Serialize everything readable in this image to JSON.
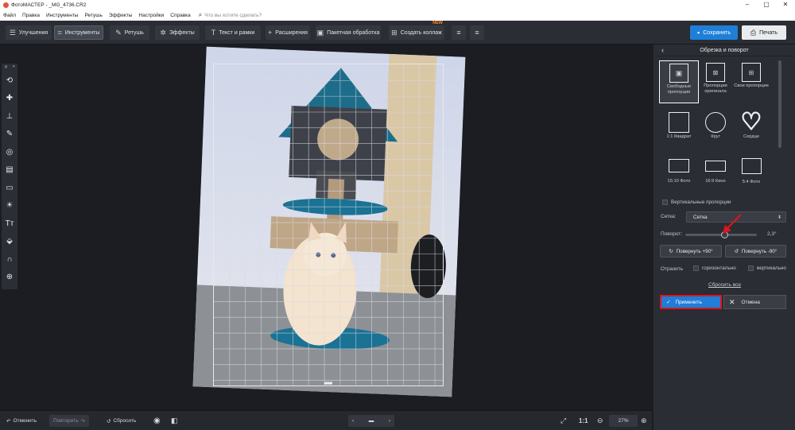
{
  "titlebar": {
    "title": "ФотоМАСТЕР - _MG_4736.CR2"
  },
  "menu": {
    "items": [
      "Файл",
      "Правка",
      "Инструменты",
      "Ретушь",
      "Эффекты",
      "Настройки",
      "Справка"
    ],
    "search_placeholder": "Что вы хотите сделать?"
  },
  "toolbar": {
    "tabs": [
      "Улучшения",
      "Инструменты",
      "Ретушь",
      "Эффекты",
      "Текст и рамки",
      "Расширения"
    ],
    "batch": "Пакетная обработка",
    "collage": "Создать коллаж",
    "collage_badge": "NEW",
    "save": "Сохранить",
    "print": "Печать"
  },
  "panel": {
    "title": "Обрезка и поворот",
    "presets": [
      {
        "label": "Свободные пропорции",
        "icon": "free-crop-icon",
        "selected": true
      },
      {
        "label": "Пропорции оригинала",
        "icon": "original-ratio-icon",
        "selected": false
      },
      {
        "label": "Свои пропорции",
        "icon": "custom-ratio-icon",
        "selected": false
      },
      {
        "label": "1:1 Квадрат",
        "icon": "square-icon",
        "selected": false
      },
      {
        "label": "Круг",
        "icon": "circle-icon",
        "selected": false
      },
      {
        "label": "Сердце",
        "icon": "heart-icon",
        "selected": false
      },
      {
        "label": "15:10 Фото",
        "icon": "rect-15-10-icon",
        "selected": false
      },
      {
        "label": "16:9 Кино",
        "icon": "rect-16-9-icon",
        "selected": false
      },
      {
        "label": "5:4 Фото",
        "icon": "rect-5-4-icon",
        "selected": false
      }
    ],
    "vertical_label": "Вертикальные пропорции",
    "grid_label": "Сетка:",
    "grid_value": "Сетка",
    "rotation_label": "Поворот:",
    "rotation_value": "2,3°",
    "rotation_fraction": 0.55,
    "rotate_plus": "Повернуть +90°",
    "rotate_minus": "Повернуть -90°",
    "flip_label": "Отразить",
    "flip_h": "горизонтально",
    "flip_v": "вертикально",
    "reset_all": "Сбросить все",
    "apply": "Применить",
    "cancel": "Отмена"
  },
  "bottom": {
    "undo": "Отменить",
    "redo": "Повторить",
    "reset": "Сбросить",
    "ratio": "1:1",
    "zoom": "27%"
  }
}
